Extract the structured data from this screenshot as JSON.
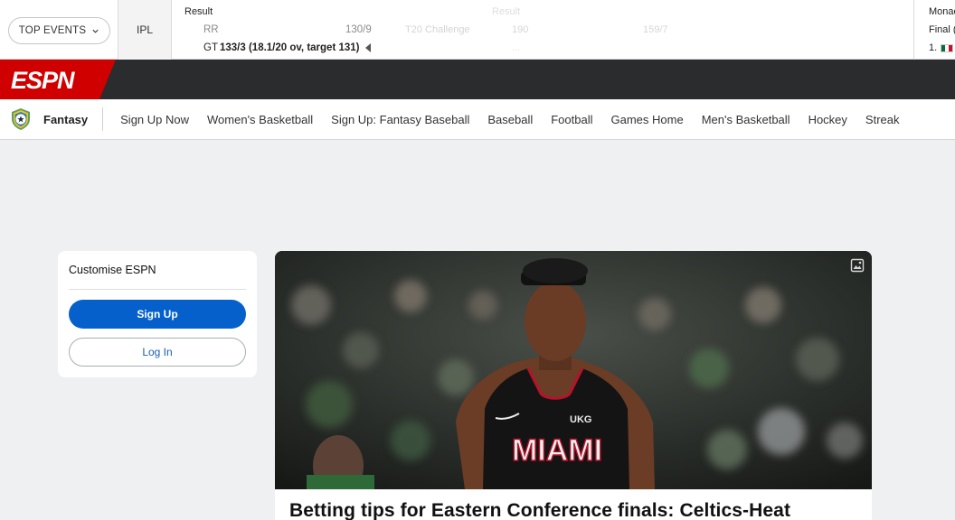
{
  "scores": {
    "top_events_label": "TOP EVENTS",
    "league": "IPL",
    "game1": {
      "status": "Result",
      "team1": "RR",
      "score1": "130/9",
      "team2": "GT",
      "score2": "133/3 (18.1/20 ov, target 131)"
    },
    "game2": {
      "series": "T20 Challenge",
      "status": "Result",
      "score1": "190",
      "score2": "159/7",
      "score3": "..."
    },
    "game3": {
      "title": "Monac",
      "status": "Final (",
      "position": "1."
    }
  },
  "brand": {
    "logo_text": "ESPN",
    "accent": "#d00000"
  },
  "subnav": {
    "brand_label": "Fantasy",
    "brand_icon": "fantasy-star-shield-icon",
    "links": [
      "Sign Up Now",
      "Women's Basketball",
      "Sign Up: Fantasy Baseball",
      "Baseball",
      "Football",
      "Games Home",
      "Men's Basketball",
      "Hockey",
      "Streak"
    ]
  },
  "customise": {
    "title": "Customise ESPN",
    "signup_label": "Sign Up",
    "login_label": "Log In"
  },
  "hero": {
    "jersey_text": "MIAMI",
    "sponsor_text": "UKG",
    "headline": "Betting tips for Eastern Conference finals: Celtics-Heat"
  }
}
